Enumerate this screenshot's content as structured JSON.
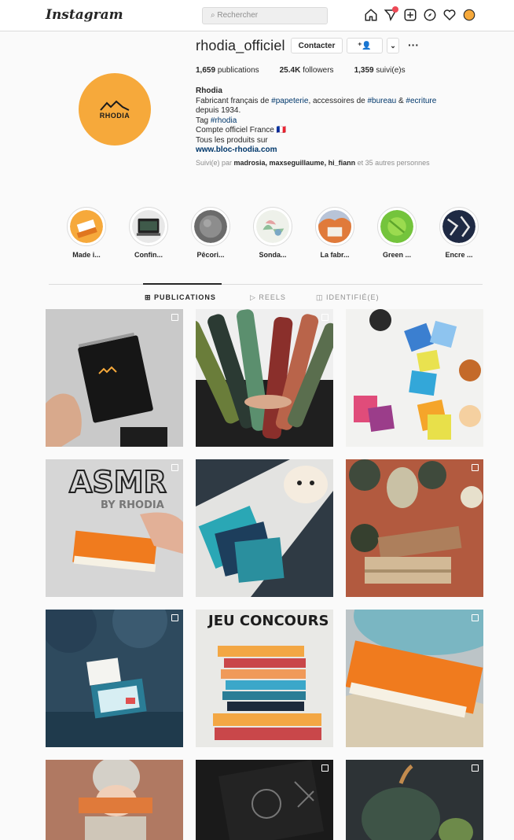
{
  "nav": {
    "logo": "Instagram",
    "search_placeholder": "Rechercher",
    "icons": [
      "home-icon",
      "direct-message-icon",
      "new-post-icon",
      "explore-icon",
      "activity-heart-icon",
      "profile-icon"
    ]
  },
  "profile": {
    "username": "rhodia_officiel",
    "contact_label": "Contacter",
    "follow_label": "⁺👤",
    "more_label": "⌄",
    "options_label": "···",
    "avatar_text": "RHODIA",
    "stats": {
      "publications": "1,659",
      "publications_label": "publications",
      "followers": "25.4K",
      "followers_label": "followers",
      "following": "1,359",
      "following_label": "suivi(e)s"
    },
    "bio": {
      "name": "Rhodia",
      "line1_pre": "Fabricant français de ",
      "tag1": "#papeterie",
      "line1_mid": ", accessoires de ",
      "tag2": "#bureau",
      "line1_amp": " & ",
      "tag3": "#ecriture",
      "line2": "depuis 1934.",
      "line3_pre": "Tag ",
      "tag4": "#rhodia",
      "line4": "Compte officiel France 🇫🇷",
      "line5": "Tous les produits sur",
      "website": "www.bloc-rhodia.com",
      "followed_pre": "Suivi(e) par ",
      "followed_names": "madrosia, maxseguillaume, hi_fiann",
      "followed_post": " et 35 autres personnes"
    }
  },
  "highlights": [
    {
      "label": "Made i..."
    },
    {
      "label": "Confin..."
    },
    {
      "label": "Pêcori..."
    },
    {
      "label": "Sonda..."
    },
    {
      "label": "La fabr..."
    },
    {
      "label": "Green ..."
    },
    {
      "label": "Encre ..."
    }
  ],
  "tabs": {
    "publications": "⊞ PUBLICATIONS",
    "reels": "▷ REELS",
    "tagged": "◫ IDENTIFIÉ(E)"
  },
  "posts": {
    "asmr_title": "ASMR",
    "asmr_sub": "BY RHODIA",
    "contest_title": "JEU CONCOURS"
  },
  "colors": {
    "brand_orange": "#f6a93b",
    "link": "#00376b",
    "border": "#dbdbdb",
    "notification": "#ed4956"
  }
}
